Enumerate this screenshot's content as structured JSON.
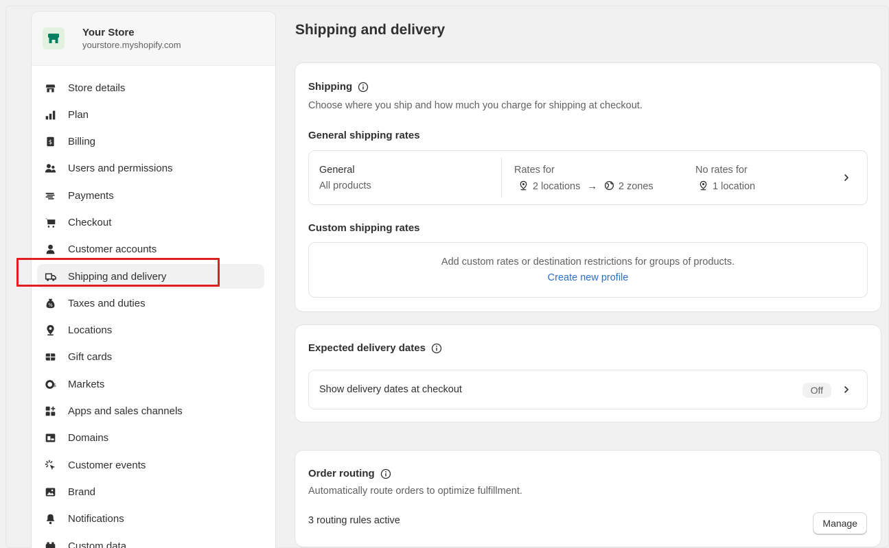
{
  "store": {
    "name": "Your Store",
    "url": "yourstore.myshopify.com"
  },
  "sidebar": {
    "items": [
      {
        "label": "Store details",
        "icon": "store-icon"
      },
      {
        "label": "Plan",
        "icon": "plan-icon"
      },
      {
        "label": "Billing",
        "icon": "billing-icon"
      },
      {
        "label": "Users and permissions",
        "icon": "users-icon"
      },
      {
        "label": "Payments",
        "icon": "payments-icon"
      },
      {
        "label": "Checkout",
        "icon": "cart-icon"
      },
      {
        "label": "Customer accounts",
        "icon": "person-icon"
      },
      {
        "label": "Shipping and delivery",
        "icon": "truck-icon",
        "active": true
      },
      {
        "label": "Taxes and duties",
        "icon": "tax-icon"
      },
      {
        "label": "Locations",
        "icon": "location-icon"
      },
      {
        "label": "Gift cards",
        "icon": "gift-card-icon"
      },
      {
        "label": "Markets",
        "icon": "markets-icon"
      },
      {
        "label": "Apps and sales channels",
        "icon": "apps-icon"
      },
      {
        "label": "Domains",
        "icon": "domains-icon"
      },
      {
        "label": "Customer events",
        "icon": "events-icon"
      },
      {
        "label": "Brand",
        "icon": "brand-icon"
      },
      {
        "label": "Notifications",
        "icon": "bell-icon"
      },
      {
        "label": "Custom data",
        "icon": "custom-data-icon"
      }
    ]
  },
  "page": {
    "title": "Shipping and delivery"
  },
  "shipping": {
    "title": "Shipping",
    "description": "Choose where you ship and how much you charge for shipping at checkout.",
    "general_heading": "General shipping rates",
    "general": {
      "name": "General",
      "subtitle": "All products",
      "rates_for_label": "Rates for",
      "locations": "2 locations",
      "arrow": "→",
      "zones": "2 zones",
      "no_rates_label": "No rates for",
      "no_rates_value": "1 location"
    },
    "custom_heading": "Custom shipping rates",
    "custom_text": "Add custom rates or destination restrictions for groups of products.",
    "custom_link": "Create new profile"
  },
  "delivery_dates": {
    "title": "Expected delivery dates",
    "row_label": "Show delivery dates at checkout",
    "status": "Off"
  },
  "order_routing": {
    "title": "Order routing",
    "description": "Automatically route orders to optimize fulfillment.",
    "status": "3 routing rules active",
    "button": "Manage"
  },
  "colors": {
    "highlight": "#e02020",
    "link": "#2c6ecb",
    "brand_green": "#008060"
  }
}
